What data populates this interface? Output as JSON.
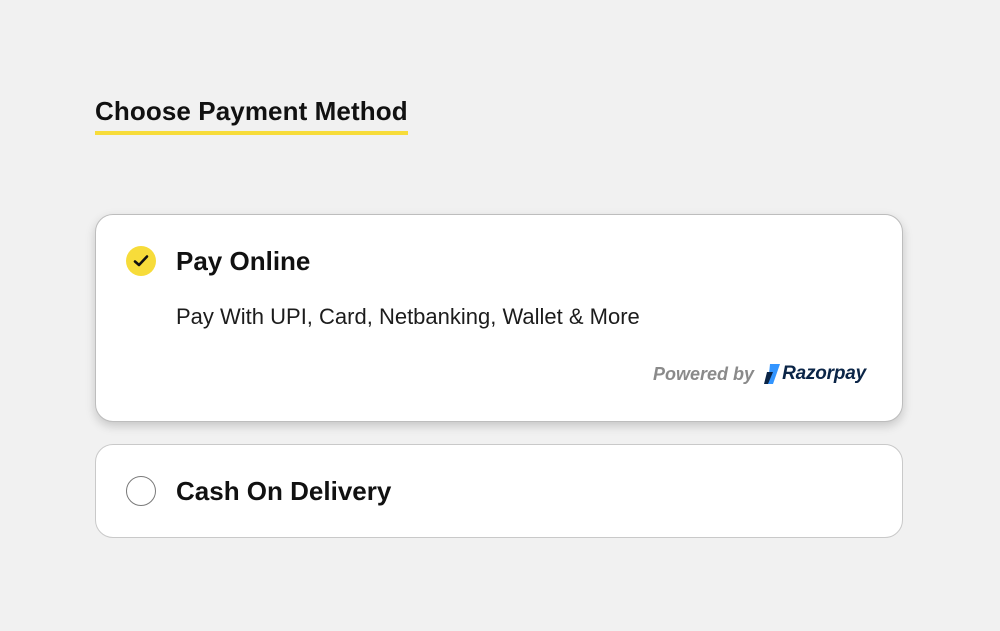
{
  "page": {
    "title": "Choose Payment Method"
  },
  "options": [
    {
      "id": "pay-online",
      "label": "Pay Online",
      "description": "Pay With UPI, Card, Netbanking, Wallet & More",
      "selected": true,
      "powered_by_label": "Powered by",
      "provider_logo": {
        "icon": "razorpay-logo-icon",
        "name": "Razorpay"
      }
    },
    {
      "id": "cash-on-delivery",
      "label": "Cash On Delivery",
      "selected": false
    }
  ],
  "colors": {
    "background": "#f1f1f1",
    "accent_yellow": "#f7dc3a",
    "card_background": "#ffffff",
    "razorpay_blue": "#3395ff",
    "razorpay_navy": "#0b2547",
    "muted_text": "#8a8a8a"
  },
  "icons": {
    "selected_radio": "check-icon",
    "unselected_radio": "empty-circle"
  }
}
